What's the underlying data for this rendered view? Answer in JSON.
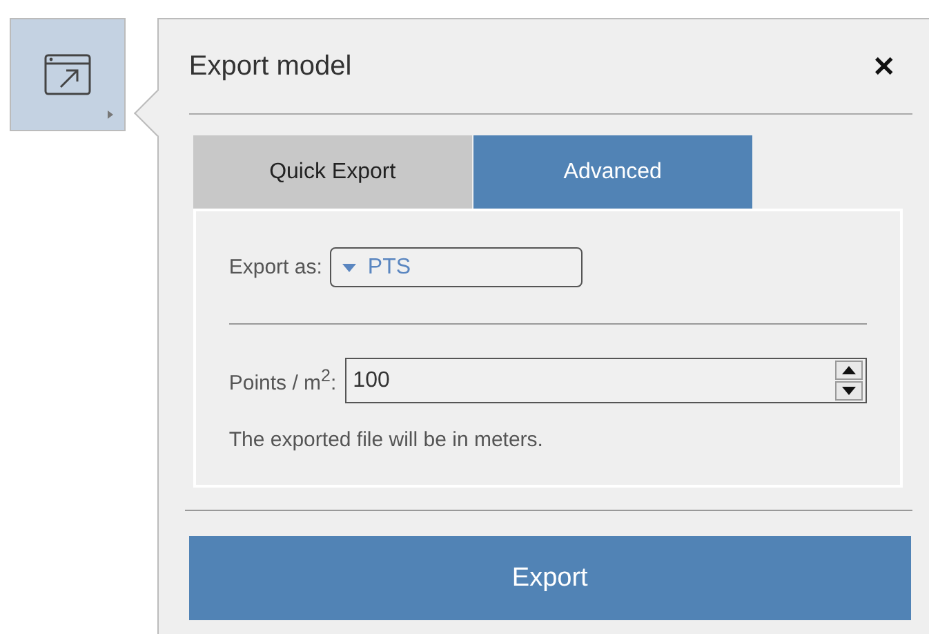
{
  "toolbar": {
    "selected": true
  },
  "dialog": {
    "title": "Export model",
    "close": "✕"
  },
  "tabs": [
    {
      "label": "Quick Export",
      "selected": false
    },
    {
      "label": "Advanced",
      "selected": true
    }
  ],
  "export_as": {
    "label": "Export as:",
    "value": "PTS"
  },
  "points": {
    "label": "Points / m$^{2}$:",
    "value": "100"
  },
  "note": "The exported file will be in meters.",
  "export_button": "Export"
}
